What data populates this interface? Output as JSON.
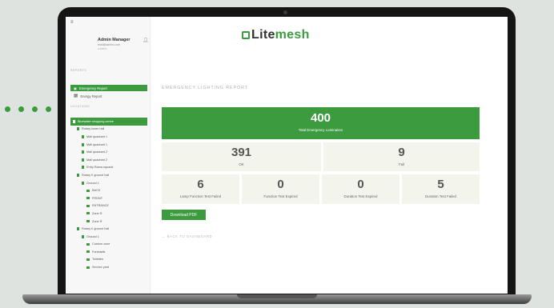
{
  "app": {
    "logo_main": "Lite",
    "logo_accent": "mesh"
  },
  "profile": {
    "name": "Admin Manager",
    "email": "mail@admin.com",
    "role": "a Admin"
  },
  "sidebar": {
    "section_reports": "REPORTS",
    "section_locations": "LOCATIONS",
    "reports": [
      {
        "label": "Emergency Report",
        "active": true
      },
      {
        "label": "Energy Report",
        "active": false
      }
    ],
    "tree": [
      {
        "label": "Bluewater shopping centre",
        "level": 0,
        "active": true
      },
      {
        "label": "Rotary lower hall",
        "level": 1
      },
      {
        "label": "Mall quadrant 1",
        "level": 2
      },
      {
        "label": "Mall quadrant 1",
        "level": 2
      },
      {
        "label": "Mall quadrant 2",
        "level": 2
      },
      {
        "label": "Mall quadrant 2",
        "level": 2
      },
      {
        "label": "Entry Rama squads",
        "level": 2
      },
      {
        "label": "Rotary II ground hall",
        "level": 1
      },
      {
        "label": "Ground 1",
        "level": 2
      },
      {
        "label": "BACK",
        "level": 3
      },
      {
        "label": "FRONT",
        "level": 3
      },
      {
        "label": "ENTRANCE",
        "level": 3
      },
      {
        "label": "Zone R",
        "level": 3
      },
      {
        "label": "Zone R",
        "level": 3
      },
      {
        "label": "Rotary II ground hall",
        "level": 1
      },
      {
        "label": "Ground 1",
        "level": 2
      },
      {
        "label": "Custom zone",
        "level": 3
      },
      {
        "label": "Forestalls",
        "level": 3
      },
      {
        "label": "Toilettes",
        "level": 3
      },
      {
        "label": "Service yard",
        "level": 3
      }
    ]
  },
  "main": {
    "page_title": "EMERGENCY LIGHTING REPORT",
    "total": {
      "value": "400",
      "label": "Total Emergency Luminaires"
    },
    "ok": {
      "value": "391",
      "label": "OK"
    },
    "fail": {
      "value": "9",
      "label": "Fail"
    },
    "lamp_failed": {
      "value": "6",
      "label": "Lamp Function Test Failed"
    },
    "function_expired": {
      "value": "0",
      "label": "Function Test Expired"
    },
    "duration_expired": {
      "value": "0",
      "label": "Duration Test Expired"
    },
    "duration_failed": {
      "value": "5",
      "label": "Duration Test Failed"
    },
    "download_label": "Download PDF",
    "back_label": "← BACK TO DASHBOARD"
  },
  "colors": {
    "accent": "#3d9b3f",
    "card_bg": "#f3f5ec"
  }
}
